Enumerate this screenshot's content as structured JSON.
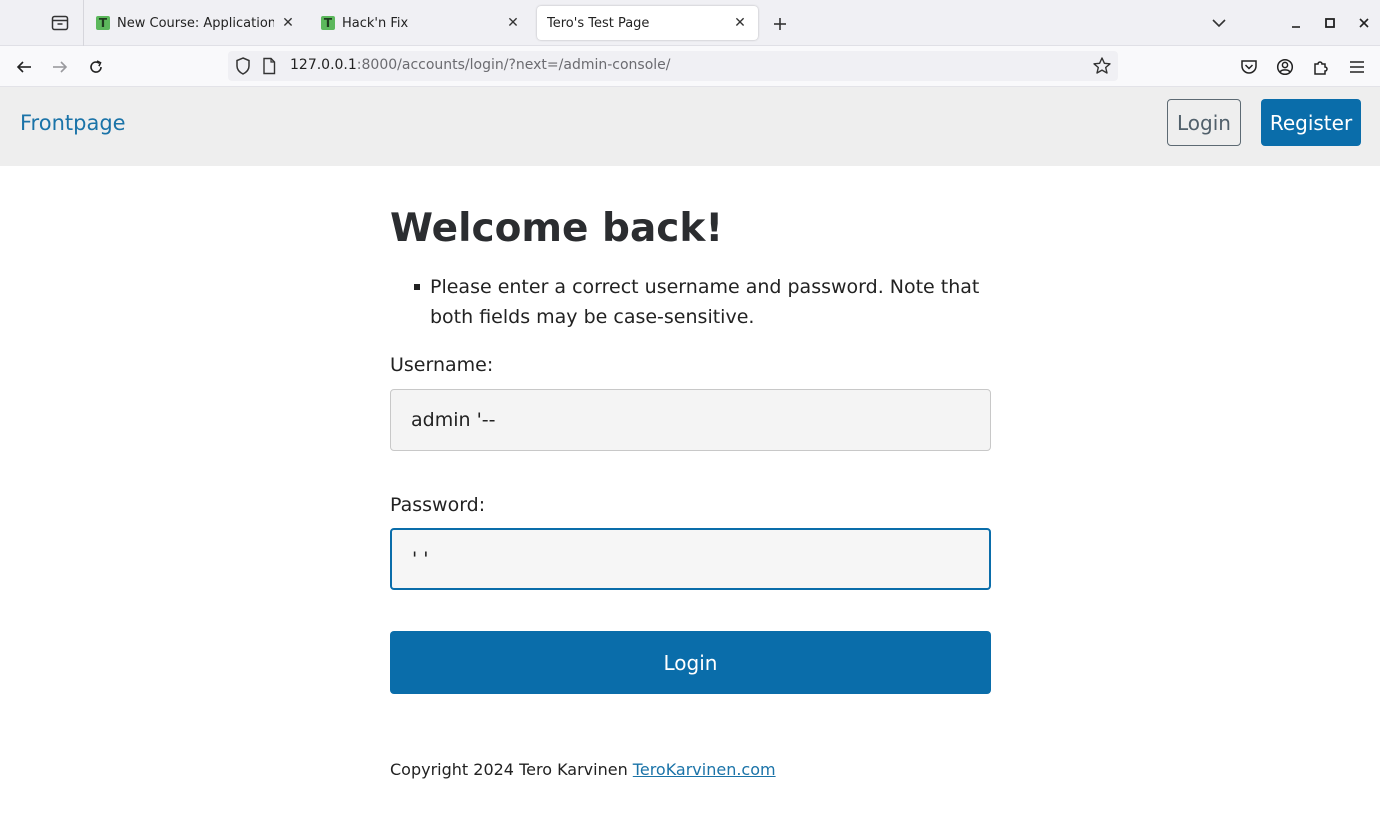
{
  "browser": {
    "tabs": [
      {
        "title": "New Course: Application H",
        "favicon": "T",
        "active": false
      },
      {
        "title": "Hack'n Fix",
        "favicon": "T",
        "active": false
      },
      {
        "title": "Tero's Test Page",
        "favicon": "",
        "active": true
      }
    ],
    "url": {
      "host": "127.0.0.1",
      "rest": ":8000/accounts/login/?next=/admin-console/"
    },
    "icons": {
      "tab_list": "tab-list-icon",
      "new_tab": "plus-icon",
      "list_all_tabs": "chevron-down-icon",
      "minimize": "minimize-icon",
      "maximize": "maximize-icon",
      "close_window": "close-icon",
      "back": "back-arrow-icon",
      "forward": "forward-arrow-icon",
      "reload": "reload-icon",
      "shield": "shield-icon",
      "page": "page-icon",
      "bookmark": "star-icon",
      "pocket": "pocket-icon",
      "account": "account-icon",
      "extensions": "extensions-icon",
      "menu": "hamburger-menu-icon"
    }
  },
  "header": {
    "brand": "Frontpage",
    "login_label": "Login",
    "register_label": "Register"
  },
  "main": {
    "heading": "Welcome back!",
    "error": "Please enter a correct username and password. Note that both fields may be case-sensitive.",
    "username_label": "Username:",
    "username_value": "admin '--",
    "password_label": "Password:",
    "password_value": "' '",
    "submit_label": "Login"
  },
  "footer": {
    "copyright": "Copyright 2024 Tero Karvinen",
    "link_text": "TeroKarvinen.com"
  },
  "colors": {
    "accent": "#0a6daa",
    "link": "#1a73a8",
    "header_bg": "#eeeeee"
  }
}
